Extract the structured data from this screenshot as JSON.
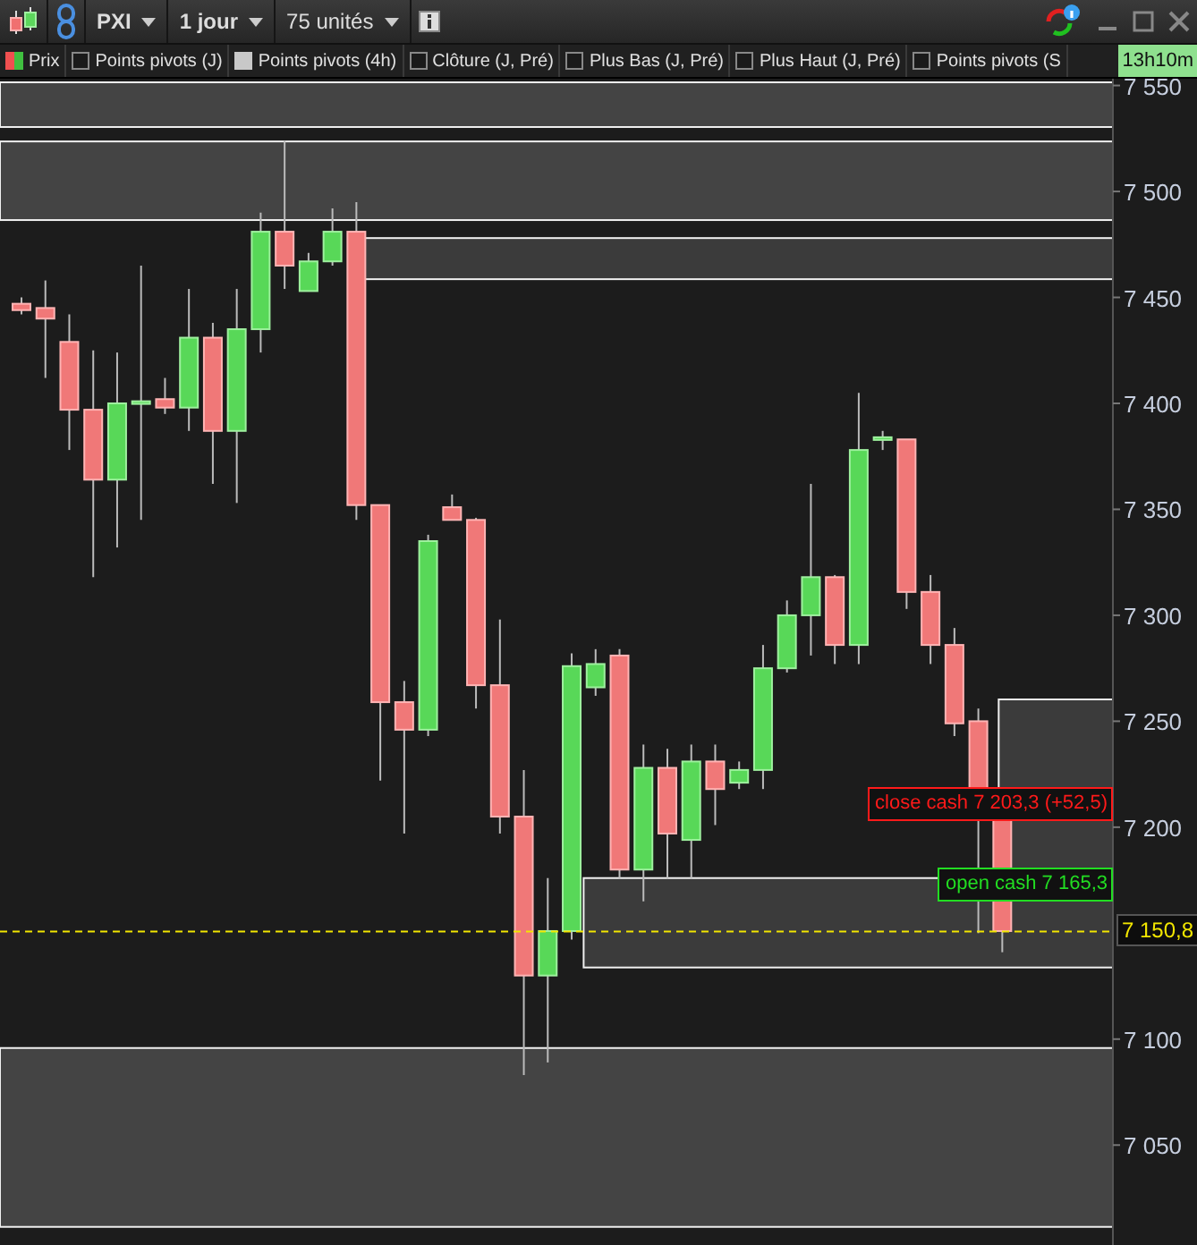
{
  "toolbar": {
    "symbol": "PXI",
    "period": "1 jour",
    "units": "75 unités"
  },
  "legend": [
    {
      "kind": "swatch",
      "label": "Prix"
    },
    {
      "kind": "checkbox",
      "label": "Points pivots (J)",
      "checked": false
    },
    {
      "kind": "checkbox",
      "label": "Points pivots (4h)",
      "checked": true
    },
    {
      "kind": "checkbox",
      "label": "Clôture (J, Pré)",
      "checked": false
    },
    {
      "kind": "checkbox",
      "label": "Plus Bas (J, Pré)",
      "checked": false
    },
    {
      "kind": "checkbox",
      "label": "Plus Haut (J, Pré)",
      "checked": false
    },
    {
      "kind": "checkbox",
      "label": "Points pivots (S",
      "checked": false
    }
  ],
  "timer": "13h10m",
  "chart": {
    "chart_data": {
      "type": "candlestick",
      "ylim": [
        7002,
        7553.2
      ],
      "yticks": [
        {
          "value": 7550,
          "label": "7 550"
        },
        {
          "value": 7500,
          "label": "7 500"
        },
        {
          "value": 7450,
          "label": "7 450"
        },
        {
          "value": 7400,
          "label": "7 400"
        },
        {
          "value": 7350,
          "label": "7 350"
        },
        {
          "value": 7300,
          "label": "7 300"
        },
        {
          "value": 7250,
          "label": "7 250"
        },
        {
          "value": 7200,
          "label": "7 200"
        },
        {
          "value": 7100,
          "label": "7 100"
        },
        {
          "value": 7050,
          "label": "7 050"
        }
      ],
      "ohlc": [
        [
          7447,
          7450,
          7442,
          7444
        ],
        [
          7445,
          7458,
          7412,
          7440
        ],
        [
          7429,
          7442,
          7378,
          7397
        ],
        [
          7397,
          7425,
          7318,
          7364
        ],
        [
          7364,
          7424,
          7332,
          7400
        ],
        [
          7400,
          7465,
          7345,
          7401
        ],
        [
          7402,
          7412,
          7395,
          7398
        ],
        [
          7398,
          7454,
          7387,
          7431
        ],
        [
          7431,
          7438,
          7362,
          7387
        ],
        [
          7387,
          7454,
          7353,
          7435
        ],
        [
          7435,
          7490,
          7424,
          7481
        ],
        [
          7481,
          7524,
          7454,
          7465
        ],
        [
          7453,
          7471,
          7453,
          7467
        ],
        [
          7467,
          7492,
          7465,
          7481
        ],
        [
          7481,
          7495,
          7345,
          7352
        ],
        [
          7352,
          7352,
          7222,
          7259
        ],
        [
          7259,
          7269,
          7197,
          7246
        ],
        [
          7246,
          7338,
          7243,
          7335
        ],
        [
          7351,
          7357,
          7345,
          7345
        ],
        [
          7345,
          7346,
          7256,
          7267
        ],
        [
          7267,
          7298,
          7197,
          7205
        ],
        [
          7205,
          7227,
          7083,
          7130
        ],
        [
          7130,
          7176,
          7089,
          7151
        ],
        [
          7151,
          7282,
          7147,
          7276
        ],
        [
          7266,
          7284,
          7262,
          7277
        ],
        [
          7281,
          7284,
          7176,
          7180
        ],
        [
          7180,
          7239,
          7165,
          7228
        ],
        [
          7228,
          7237,
          7176,
          7197
        ],
        [
          7194,
          7239,
          7176,
          7231
        ],
        [
          7231,
          7239,
          7201,
          7218
        ],
        [
          7221,
          7231,
          7218,
          7227
        ],
        [
          7227,
          7286,
          7218,
          7275
        ],
        [
          7275,
          7307,
          7273,
          7300
        ],
        [
          7300,
          7362,
          7281,
          7318
        ],
        [
          7318,
          7319,
          7277,
          7286
        ],
        [
          7286,
          7405,
          7277,
          7378
        ],
        [
          7383,
          7387,
          7378,
          7384
        ],
        [
          7383,
          7383,
          7303,
          7311
        ],
        [
          7311,
          7319,
          7277,
          7286
        ],
        [
          7286,
          7294,
          7243,
          7249
        ],
        [
          7250,
          7256,
          7150,
          7205
        ],
        [
          7205,
          7205,
          7141,
          7151
        ]
      ],
      "ref_lines": [
        {
          "axis": "y",
          "value": 7150.8,
          "label": "7 150,8",
          "color": "#f2e600"
        }
      ]
    },
    "close_tag": "close cash 7 203,3 (+52,5)",
    "open_tag": "open cash 7 165,3"
  }
}
